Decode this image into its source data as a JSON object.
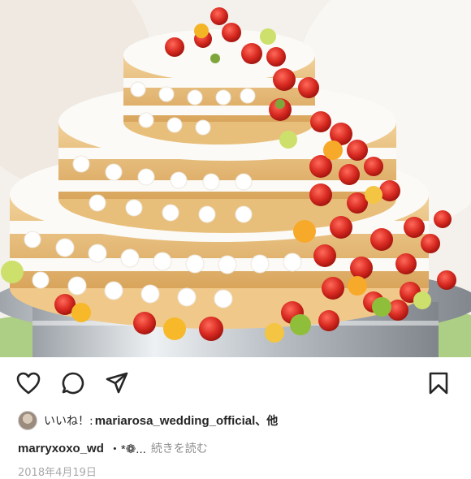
{
  "post": {
    "image_alt": "",
    "likes": {
      "prefix": "いいね！:",
      "user": "mariarosa_wedding_official",
      "suffix": "、他"
    },
    "caption": {
      "user": "marryxoxo_wd",
      "text": "・*❁...",
      "more_label": "続きを読む"
    },
    "date": "2018年4月19日"
  },
  "icons": {
    "like": "heart-icon",
    "comment": "comment-bubble-icon",
    "share": "paper-plane-icon",
    "save": "bookmark-icon"
  },
  "colors": {
    "text": "#262626",
    "muted": "#8e8e8e",
    "strawberry": "#d9362b",
    "cream": "#fbfaf6",
    "sponge": "#e8bf7a"
  }
}
